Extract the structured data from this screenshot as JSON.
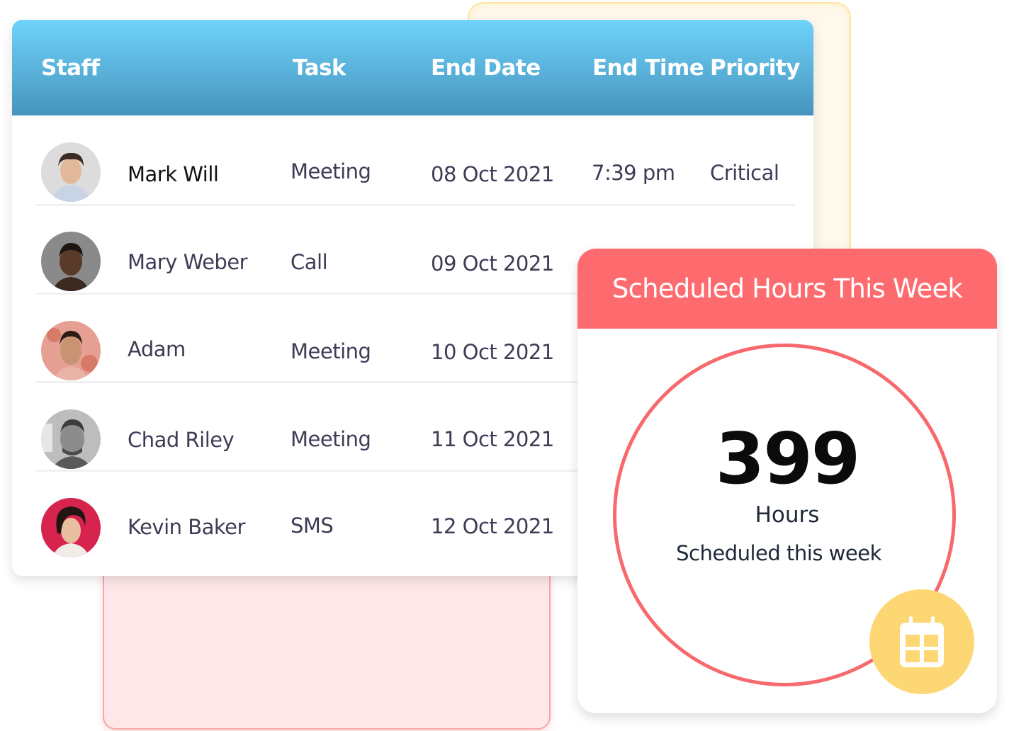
{
  "table": {
    "headers": [
      "Staff",
      "Task",
      "End Date",
      "End Time",
      "Priority"
    ],
    "rows": [
      {
        "name": "Mark Will",
        "task": "Meeting",
        "end_date": "08 Oct 2021",
        "end_time": "7:39 pm",
        "priority": "Critical",
        "avatar_color": "#d8d8d8"
      },
      {
        "name": "Mary Weber",
        "task": "Call",
        "end_date": "09 Oct 2021",
        "end_time": "",
        "priority": "",
        "avatar_color": "#7d7d7d"
      },
      {
        "name": "Adam",
        "task": "Meeting",
        "end_date": "10 Oct 2021",
        "end_time": "",
        "priority": "",
        "avatar_color": "#e8a79a"
      },
      {
        "name": "Chad Riley",
        "task": "Meeting",
        "end_date": "11 Oct 2021",
        "end_time": "",
        "priority": "",
        "avatar_color": "#9a9a9a"
      },
      {
        "name": "Kevin Baker",
        "task": "SMS",
        "end_date": "12 Oct 2021",
        "end_time": "",
        "priority": "",
        "avatar_color": "#d6244f"
      }
    ]
  },
  "hours_card": {
    "title": "Scheduled Hours This Week",
    "value": "399",
    "unit_label": "Hours",
    "sub_label": "Scheduled this week",
    "icon": "calendar-icon"
  },
  "colors": {
    "header_gradient_top": "#6fd3fb",
    "header_gradient_bottom": "#4694bd",
    "hours_header": "#fd6b6f",
    "ring": "#f7696c",
    "calendar_button": "#fdd774"
  }
}
